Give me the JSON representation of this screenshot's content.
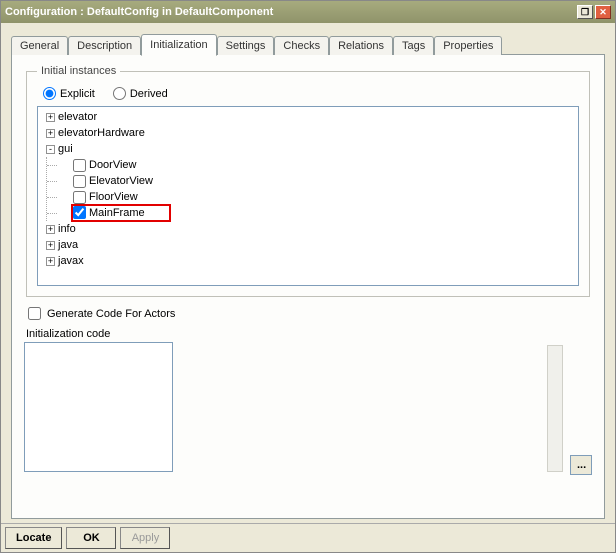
{
  "window": {
    "title": "Configuration : DefaultConfig in DefaultComponent"
  },
  "tabs": [
    {
      "label": "General"
    },
    {
      "label": "Description"
    },
    {
      "label": "Initialization",
      "active": true
    },
    {
      "label": "Settings"
    },
    {
      "label": "Checks"
    },
    {
      "label": "Relations"
    },
    {
      "label": "Tags"
    },
    {
      "label": "Properties"
    }
  ],
  "fieldset": {
    "legend": "Initial instances"
  },
  "radios": {
    "explicit": "Explicit",
    "derived": "Derived",
    "selected": "explicit"
  },
  "tree": {
    "nodes": [
      {
        "label": "elevator",
        "state": "collapsed"
      },
      {
        "label": "elevatorHardware",
        "state": "collapsed"
      },
      {
        "label": "gui",
        "state": "expanded",
        "children": [
          {
            "label": "DoorView",
            "checked": false
          },
          {
            "label": "ElevatorView",
            "checked": false
          },
          {
            "label": "FloorView",
            "checked": false
          },
          {
            "label": "MainFrame",
            "checked": true,
            "highlight": true
          }
        ]
      },
      {
        "label": "info",
        "state": "collapsed"
      },
      {
        "label": "java",
        "state": "collapsed"
      },
      {
        "label": "javax",
        "state": "collapsed"
      }
    ]
  },
  "gen_actors": {
    "label": "Generate Code For Actors",
    "checked": false
  },
  "init_code": {
    "label": "Initialization code",
    "value": ""
  },
  "ellipsis_btn": "...",
  "buttons": {
    "locate": "Locate",
    "ok": "OK",
    "apply": "Apply"
  }
}
